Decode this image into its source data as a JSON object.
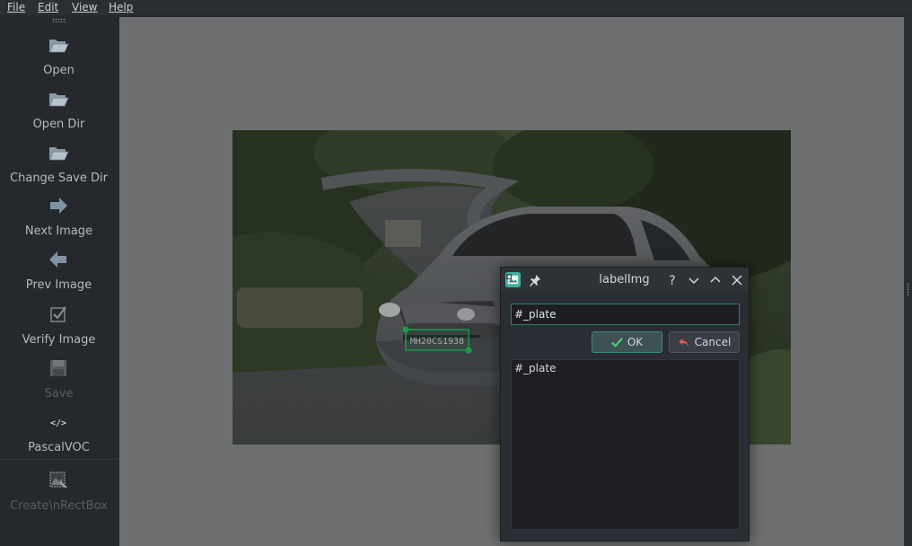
{
  "menubar": {
    "items": [
      {
        "label": "File"
      },
      {
        "label": "Edit"
      },
      {
        "label": "View"
      },
      {
        "label": "Help"
      }
    ]
  },
  "toolbar": {
    "tools": [
      {
        "label": "Open",
        "icon": "folder-open-icon",
        "enabled": true
      },
      {
        "label": "Open Dir",
        "icon": "folder-open-icon",
        "enabled": true
      },
      {
        "label": "Change Save Dir",
        "icon": "folder-open-icon",
        "enabled": true
      },
      {
        "label": "Next Image",
        "icon": "arrow-right-icon",
        "enabled": true
      },
      {
        "label": "Prev Image",
        "icon": "arrow-left-icon",
        "enabled": true
      },
      {
        "label": "Verify Image",
        "icon": "checkbox-icon",
        "enabled": true
      },
      {
        "label": "Save",
        "icon": "floppy-disk-icon",
        "enabled": false
      },
      {
        "label": "PascalVOC",
        "icon": "code-tag-icon",
        "enabled": true
      },
      {
        "label": "Create\\nRectBox",
        "icon": "rectbox-icon",
        "enabled": false
      }
    ]
  },
  "canvas": {
    "annotation": {
      "plate_text": "MH20CS1938"
    }
  },
  "dialog": {
    "title": "labelImg",
    "title_buttons": [
      "?",
      "minimize",
      "maximize",
      "close"
    ],
    "input_value": "#_plate",
    "ok_label": "OK",
    "cancel_label": "Cancel",
    "labels": [
      "#_plate"
    ]
  },
  "colors": {
    "accent": "#2f7d74",
    "canvas_bg": "#6e6f70",
    "app_bg": "#25282d",
    "box_green": "#22c55e"
  }
}
